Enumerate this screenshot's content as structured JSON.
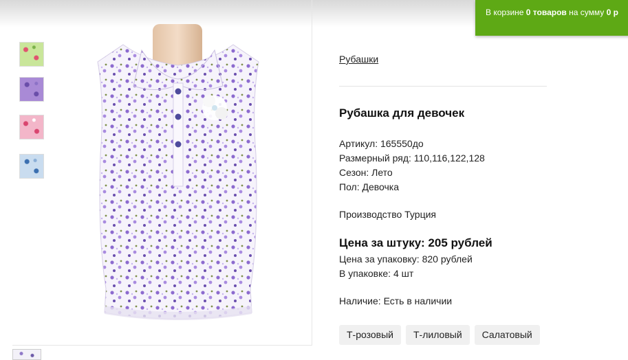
{
  "cart": {
    "prefix": "В корзине",
    "count": "0 товаров",
    "middle": "на сумму",
    "sum": "0 р"
  },
  "gallery": {
    "thumbnails": [
      {
        "color": "#c9e69a",
        "accent": "#e0546f",
        "icon": "green-floral-swatch"
      },
      {
        "color": "#a98ad6",
        "accent": "#6a4ea9",
        "icon": "lilac-floral-swatch"
      },
      {
        "color": "#f3b6c9",
        "accent": "#d9456f",
        "icon": "pink-floral-swatch"
      },
      {
        "color": "#c9dcef",
        "accent": "#3b6fb0",
        "icon": "blue-floral-swatch"
      }
    ],
    "main_photo": "sleeveless-floral-blouse-on-mannequin"
  },
  "product": {
    "breadcrumb": "Рубашки",
    "title": "Рубашка для девочек",
    "specs": [
      "Артикул: 165550до",
      "Размерный ряд: 110,116,122,128",
      "Сезон: Лето",
      "Пол: Девочка"
    ],
    "origin": "Производство Турция",
    "price_main": "Цена за штуку: 205 рублей",
    "price_pack": "Цена за упаковку: 820 рублей",
    "pack_qty": "В упаковке: 4 шт",
    "availability": "Наличие: Есть в наличии",
    "colors": [
      "Т-розовый",
      "Т-лиловый",
      "Салатовый"
    ]
  }
}
